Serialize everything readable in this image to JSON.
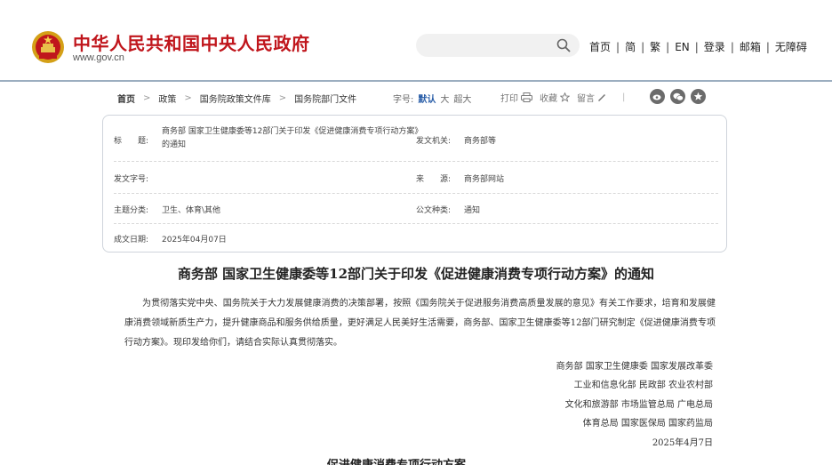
{
  "header": {
    "site_title": "中华人民共和国中央人民政府",
    "site_domain": "www.gov.cn",
    "search_placeholder": "",
    "nav": [
      "首页",
      "简",
      "繁",
      "EN",
      "登录",
      "邮箱",
      "无障碍"
    ],
    "accent_color": "#c0161c"
  },
  "breadcrumb": {
    "items": [
      "首页",
      "政策",
      "国务院政策文件库",
      "国务院部门文件"
    ],
    "font_size_label": "字号:",
    "font_sizes": [
      "默认",
      "大",
      "超大"
    ],
    "font_size_active": "默认",
    "print_label": "打印",
    "favorite_label": "收藏",
    "comment_label": "留言"
  },
  "info": {
    "title_label": "标　　题:",
    "title_value": "商务部 国家卫生健康委等12部门关于印发《促进健康消费专项行动方案》的通知",
    "issuer_label": "发文机关:",
    "issuer_value": "商务部等",
    "doc_no_label": "发文字号:",
    "doc_no_value": "",
    "source_label": "来　　源:",
    "source_value": "商务部网站",
    "category_label": "主题分类:",
    "category_value": "卫生、体育\\其他",
    "doc_type_label": "公文种类:",
    "doc_type_value": "通知",
    "date_label": "成文日期:",
    "date_value": "2025年04月07日"
  },
  "article": {
    "title": "商务部 国家卫生健康委等12部门关于印发《促进健康消费专项行动方案》的通知",
    "body": "为贯彻落实党中央、国务院关于大力发展健康消费的决策部署，按照《国务院关于促进服务消费高质量发展的意见》有关工作要求，培育和发展健康消费领域新质生产力，提升健康商品和服务供给质量，更好满足人民美好生活需要，商务部、国家卫生健康委等12部门研究制定《促进健康消费专项行动方案》。现印发给你们，请结合实际认真贯彻落实。",
    "signers": [
      "商务部 国家卫生健康委 国家发展改革委",
      "工业和信息化部 民政部 农业农村部",
      "文化和旅游部 市场监管总局 广电总局",
      "体育总局 国家医保局 国家药监局"
    ],
    "date": "2025年4月7日",
    "next_heading": "促进健康消费专项行动方案"
  }
}
